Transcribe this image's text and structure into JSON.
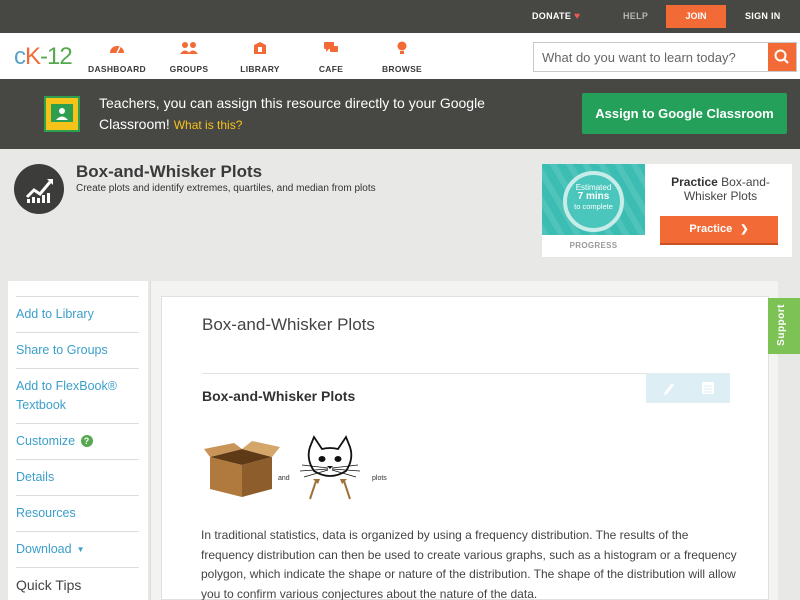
{
  "topbar": {
    "donate_label": "DONATE",
    "donate_icon": "heart-icon",
    "help_label": "HELP",
    "join_label": "JOIN",
    "signin_label": "SIGN IN"
  },
  "logo": {
    "text_c": "c",
    "text_k": "K",
    "text_n": "-12"
  },
  "nav": {
    "items": [
      {
        "label": "DASHBOARD",
        "icon": "dashboard-icon"
      },
      {
        "label": "GROUPS",
        "icon": "groups-icon"
      },
      {
        "label": "LIBRARY",
        "icon": "library-icon"
      },
      {
        "label": "CAFE",
        "icon": "cafe-icon"
      },
      {
        "label": "BROWSE",
        "icon": "browse-icon"
      }
    ],
    "search_placeholder": "What do you want to learn today?",
    "search_icon": "search-icon"
  },
  "banner": {
    "text": "Teachers, you can assign this resource directly to your Google Classroom!",
    "what_label": "What is this?",
    "assign_label": "Assign to Google Classroom"
  },
  "resource": {
    "title": "Box-and-Whisker Plots",
    "description": "Create plots and identify extremes, quartiles, and median from plots",
    "practice": {
      "estimated": "Estimated",
      "mins": "7 mins",
      "to_complete": "to complete",
      "progress_label": "PROGRESS",
      "title_bold": "Practice",
      "title_rest": "Box-and-Whisker Plots",
      "button_label": "Practice"
    }
  },
  "sidebar": {
    "items": [
      {
        "label": "Add to Library"
      },
      {
        "label": "Share to Groups"
      },
      {
        "label": "Add to FlexBook®",
        "label2": "Textbook"
      },
      {
        "label": "Customize"
      },
      {
        "label": "Details"
      },
      {
        "label": "Resources"
      },
      {
        "label": "Download"
      }
    ],
    "quick_tips": "Quick Tips"
  },
  "main": {
    "page_title": "Box-and-Whisker Plots",
    "section_title": "Box-and-Whisker Plots",
    "illus_and": "and",
    "illus_plots": "plots",
    "body": "In traditional statistics, data is organized by using a frequency distribution. The results of the frequency distribution can then be used to create various graphs, such as a histogram or a frequency polygon, which indicate the shape or nature of the distribution. The shape of the distribution will allow you to confirm various conjectures about the nature of the data."
  },
  "support_label": "Support",
  "colors": {
    "accent_orange": "#f26a35",
    "link_blue": "#3b9fcb",
    "classroom_green": "#24a05a",
    "support_green": "#7cc254"
  }
}
